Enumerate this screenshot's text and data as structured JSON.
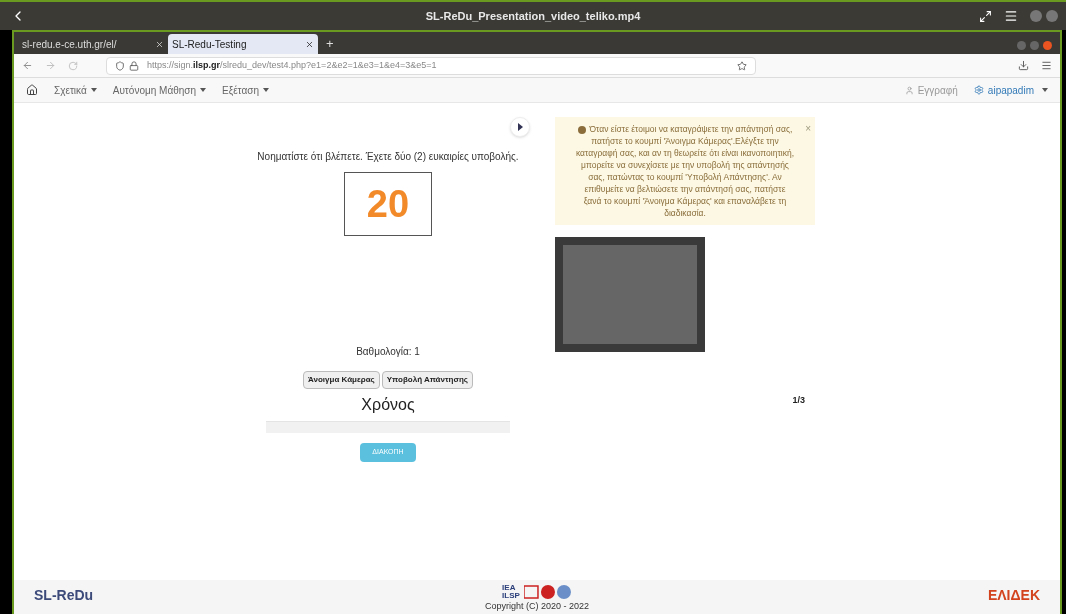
{
  "player": {
    "title": "SL-ReDu_Presentation_video_teliko.mp4"
  },
  "tabs": [
    {
      "label": "sl-redu.e-ce.uth.gr/el/",
      "selected": false
    },
    {
      "label": "SL-Redu-Testing",
      "selected": true
    }
  ],
  "tab_add": "+",
  "address": {
    "host_start": "https://sign.",
    "host_bold": "ilsp.gr",
    "path": "/slredu_dev/test4.php?e1=2&e2=1&e3=1&e4=3&e5=1"
  },
  "nav": {
    "menus": [
      "Σχετικά",
      "Αυτόνομη Μάθηση",
      "Εξέταση"
    ],
    "register": "Εγγραφή",
    "user": "aipapadim"
  },
  "task": {
    "instruction": "Νοηματίστε ότι βλέπετε. Έχετε δύο (2) ευκαιρίες υποβολής.",
    "number": "20",
    "score": "Βαθμολογία: 1",
    "buttons": [
      "Άνοιγμα Κάμερας",
      "Υποβολή Απάντησης"
    ],
    "timer_label": "Χρόνος",
    "stop": "ΔΙΑΚΟΠΗ"
  },
  "alert": {
    "text": "Όταν είστε έτοιμοι να καταγράψετε την απάντησή σας, πατήστε το κουμπί 'Άνοιγμα Κάμερας'.Ελέγξτε την καταγραφή σας, και αν τη θεωρείτε ότι είναι ικανοποιητική, μπορείτε να συνεχίσετε με την υποβολή της απάντησής σας, πατώντας το κουμπί 'Υποβολή Απάντησης'. Αν επιθυμείτε να βελτιώσετε την απάντησή σας, πατήστε ξανά το κουμπί 'Άνοιγμα Κάμερας' και επαναλάβετε τη διαδικασία.",
    "close": "×"
  },
  "page_indicator": "1/3",
  "footer": {
    "brand": "SL-ReDu",
    "partners": [
      "IEA",
      "ILSP"
    ],
    "sponsor": "ΕΛΙΔΕΚ",
    "copyright": "Copyright (C) 2020 - 2022"
  }
}
